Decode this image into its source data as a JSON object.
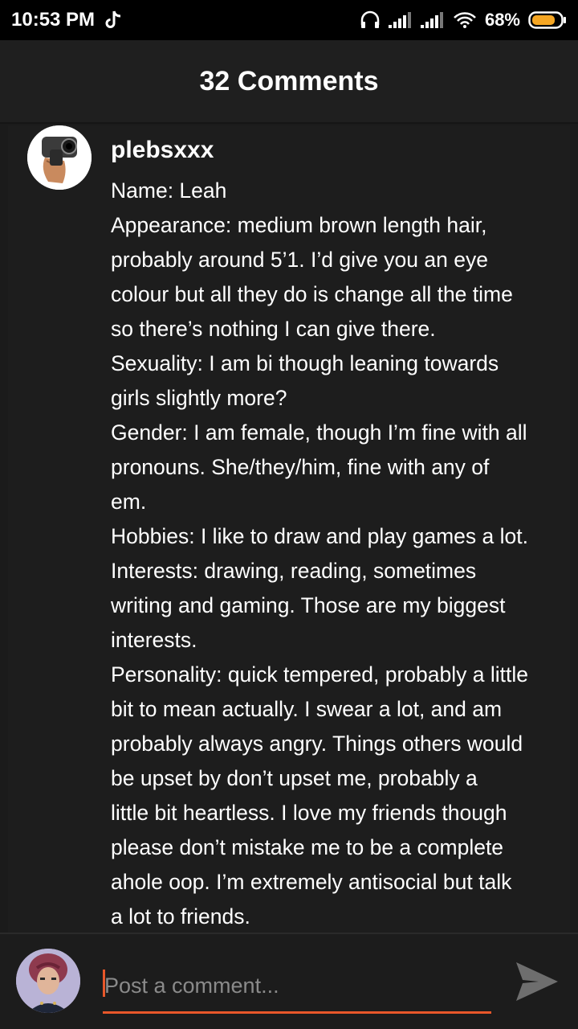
{
  "status_bar": {
    "time": "10:53 PM",
    "battery": "68%",
    "icons": [
      "tiktok-icon",
      "headphones-icon",
      "signal-icon",
      "signal-icon",
      "wifi-icon",
      "battery-icon"
    ]
  },
  "header": {
    "title": "32 Comments"
  },
  "comment": {
    "username": "plebsxxx",
    "lines": [
      "Name: Leah",
      "Appearance: medium brown length hair,",
      "probably around 5’1. I’d give you an eye",
      "colour but all they do is change all the time",
      "so there’s nothing I can give there.",
      "Sexuality: I am bi though leaning towards",
      "girls slightly more?",
      "Gender: I am female, though I’m fine with all",
      "pronouns. She/they/him, fine with any of",
      "em.",
      "Hobbies: I like to draw and play games a lot.",
      "Interests: drawing, reading, sometimes",
      "writing and gaming. Those are my biggest",
      "interests.",
      "Personality: quick tempered, probably a little",
      "bit to mean actually. I swear a lot, and am",
      "probably always angry. Things others would",
      "be upset by don’t upset me, probably a",
      "little bit heartless. I love my friends though",
      "please don’t mistake me to be a complete",
      "ahole oop. I’m extremely antisocial but talk",
      "a lot to friends."
    ]
  },
  "composer": {
    "placeholder": "Post a comment...",
    "accent": "#e8572a"
  }
}
